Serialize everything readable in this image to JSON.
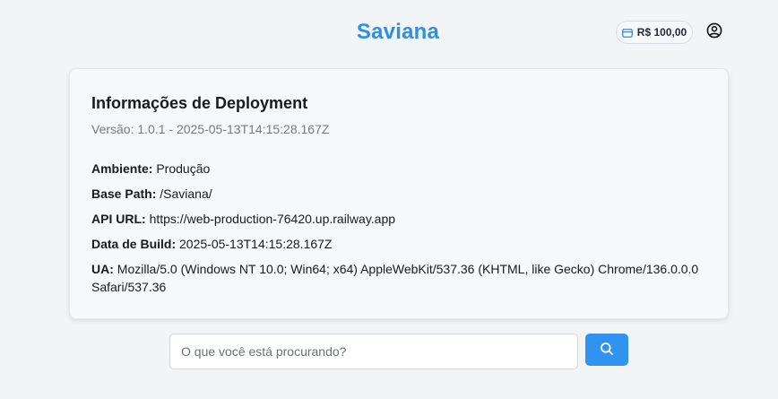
{
  "header": {
    "brand": "Saviana",
    "balance": "R$ 100,00",
    "balance_icon": "credit-card-icon",
    "user_icon": "user-circle-icon"
  },
  "deployment": {
    "title": "Informações de Deployment",
    "version": "Versão: 1.0.1 - 2025-05-13T14:15:28.167Z",
    "info": [
      {
        "key": "Ambiente:",
        "value": "Produção"
      },
      {
        "key": "Base Path:",
        "value": "/Saviana/"
      },
      {
        "key": "API URL:",
        "value": "https://web-production-76420.up.railway.app"
      },
      {
        "key": "Data de Build:",
        "value": "2025-05-13T14:15:28.167Z"
      },
      {
        "key": "UA:",
        "value": "Mozilla/5.0 (Windows NT 10.0; Win64; x64) AppleWebKit/537.36 (KHTML, like Gecko) Chrome/136.0.0.0 Safari/537.36"
      }
    ]
  },
  "search": {
    "placeholder": "O que você está procurando?",
    "value": "",
    "button_icon": "search-icon"
  },
  "colors": {
    "brand": "#2f8fe0",
    "button": "#2f93ef",
    "background": "#f3f4f6"
  }
}
